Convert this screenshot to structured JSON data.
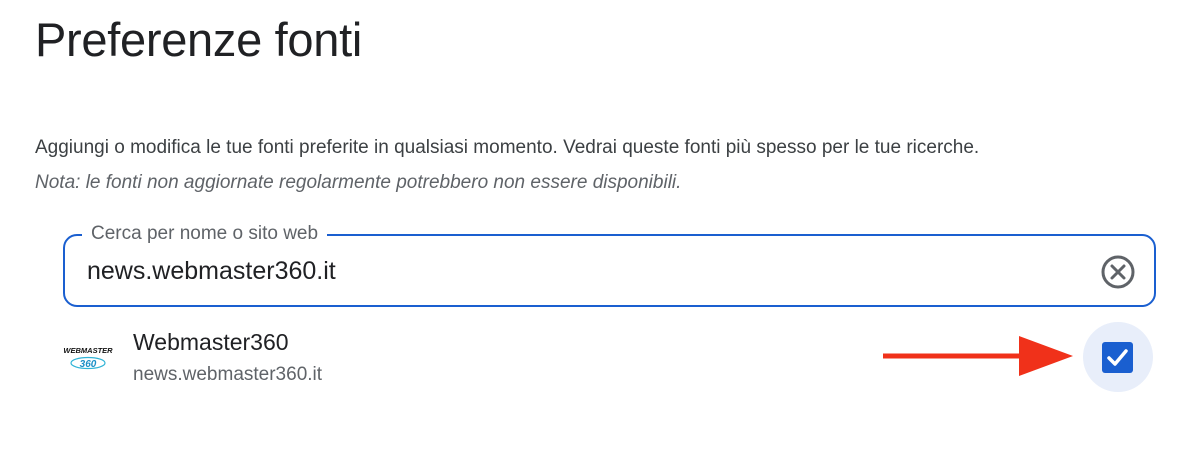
{
  "header": {
    "title": "Preferenze fonti"
  },
  "intro": {
    "description": "Aggiungi o modifica le tue fonti preferite in qualsiasi momento. Vedrai queste fonti più spesso per le tue ricerche.",
    "note": "Nota: le fonti non aggiornate regolarmente potrebbero non essere disponibili."
  },
  "search": {
    "label": "Cerca per nome o sito web",
    "value": "news.webmaster360.it",
    "clear_icon": "close-circle-icon"
  },
  "results": [
    {
      "name": "Webmaster360",
      "url": "news.webmaster360.it",
      "logo_top": "WEBMASTER",
      "logo_bottom": "360",
      "checked": true
    }
  ],
  "annotation": {
    "arrow_color": "#f0311a"
  },
  "colors": {
    "accent": "#1a5fd0",
    "checkbox_halo": "#e8eefa",
    "text_primary": "#202124",
    "text_secondary": "#5f6368"
  }
}
